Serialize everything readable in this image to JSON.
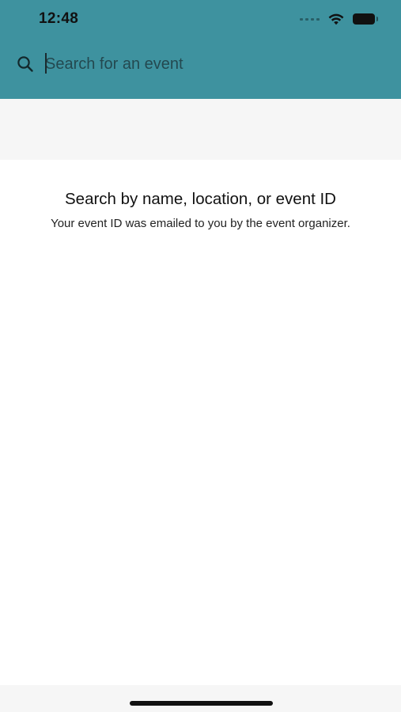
{
  "status_bar": {
    "time": "12:48",
    "icons": [
      "cellular-signal-icon",
      "wifi-icon",
      "battery-icon"
    ]
  },
  "search": {
    "placeholder": "Search for an event",
    "value": "",
    "icon": "search-icon"
  },
  "empty_state": {
    "title": "Search by name, location, or event ID",
    "subtitle": "Your event ID was emailed to you by the event organizer."
  },
  "colors": {
    "header": "#3e929f",
    "band": "#f6f6f6",
    "background": "#ffffff",
    "text": "#111111"
  }
}
